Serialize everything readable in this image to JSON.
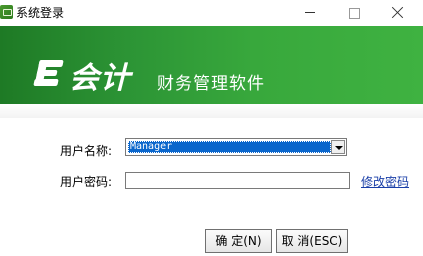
{
  "window": {
    "title": "系统登录"
  },
  "banner": {
    "logo_text": "会计",
    "subtitle": "财务管理软件"
  },
  "form": {
    "username_label": "用户名称:",
    "username_value": "Manager",
    "password_label": "用户密码:",
    "password_value": "",
    "change_password_link": "修改密码"
  },
  "buttons": {
    "ok_label": "确 定(N)",
    "cancel_label": "取 消(ESC)"
  },
  "colors": {
    "banner_green": "#2c9435",
    "selection_blue": "#0a66cc",
    "link_blue": "#1a3fa8"
  }
}
